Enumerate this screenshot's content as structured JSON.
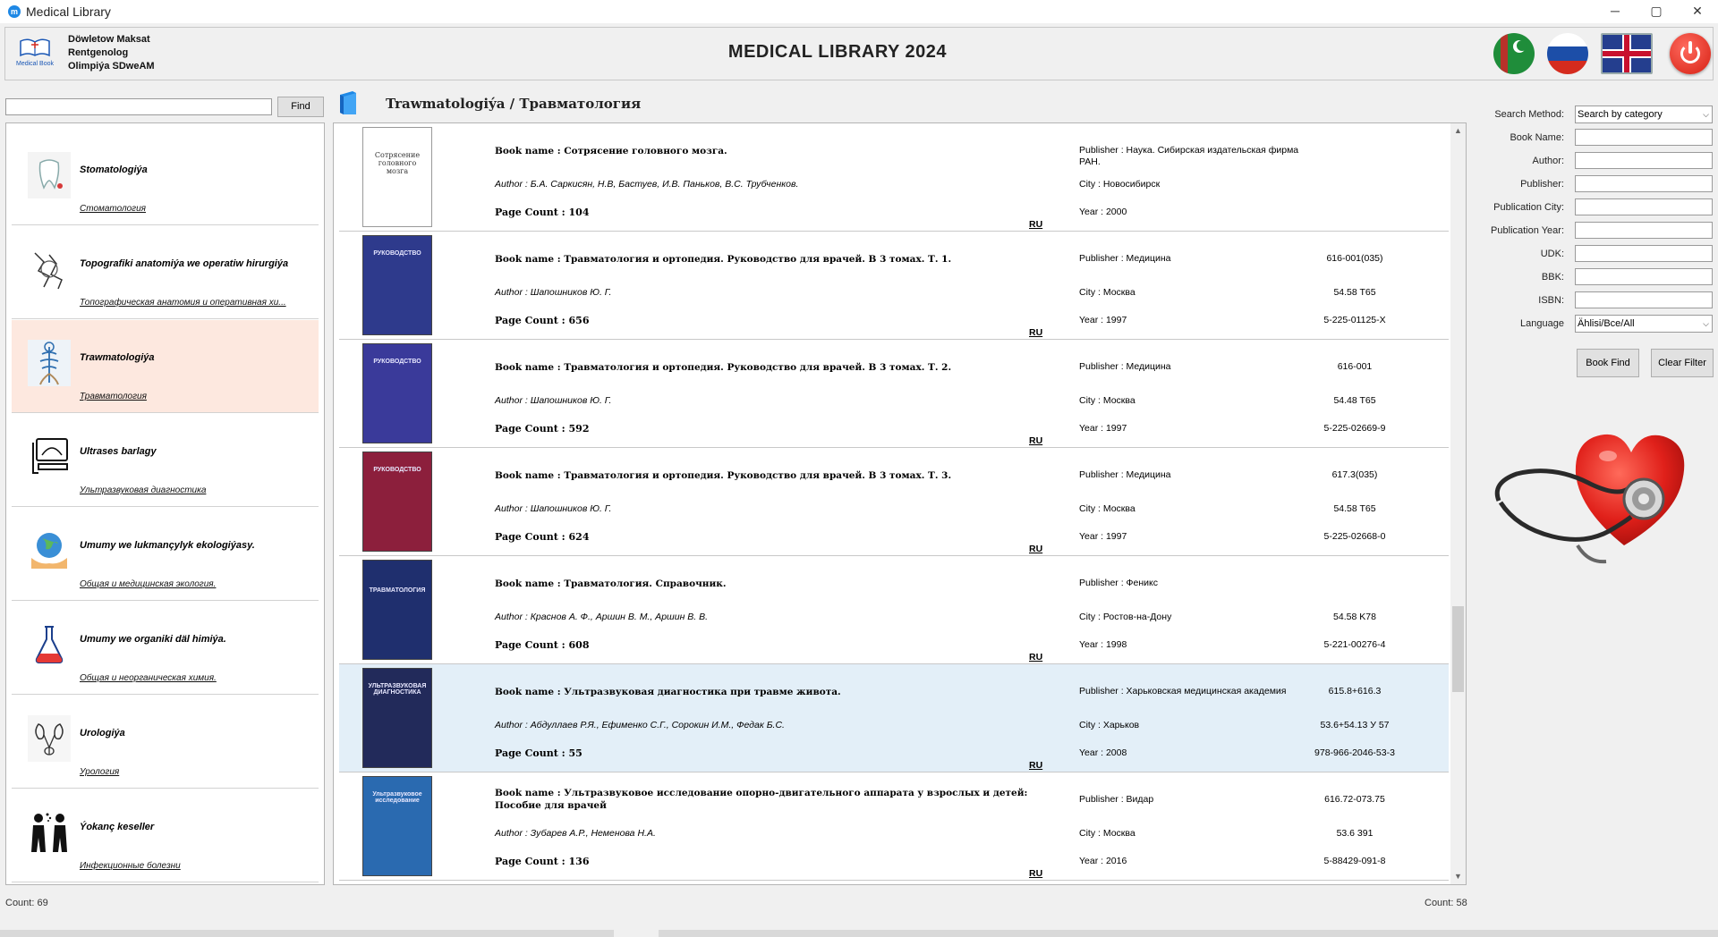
{
  "window": {
    "title": "Medical Library",
    "minimize": "─",
    "maximize": "▢",
    "close": "✕"
  },
  "header": {
    "logo_text": "Medical Book",
    "user_name": "Döwletow Maksat",
    "user_role": "Rentgenolog",
    "user_org": "Olimpiýa SDweAM",
    "app_title": "MEDICAL LIBRARY 2024"
  },
  "left": {
    "search_value": "",
    "find_label": "Find",
    "categories": [
      {
        "name": "Stomatologiýa",
        "sub": "Стоматология",
        "icon": "tooth-icon"
      },
      {
        "name": "Topografiki anatomiýa we operatiw hirurgiýa",
        "sub": "Топографическая анатомия и оперативная хи...",
        "icon": "anatomy-icon"
      },
      {
        "name": "Trawmatologiýa",
        "sub": "Травматология",
        "icon": "skeleton-icon"
      },
      {
        "name": "Ultrases barlagy",
        "sub": "Ультразвуковая диагностика",
        "icon": "ultrasound-icon"
      },
      {
        "name": "Umumy we lukmançylyk ekologiýasy.",
        "sub": "Общая и медицинская экология.",
        "icon": "globe-icon"
      },
      {
        "name": "Umumy we organiki däl himiýa.",
        "sub": "Общая и неорганическая химия.",
        "icon": "flask-icon"
      },
      {
        "name": "Urologiýa",
        "sub": "Урология",
        "icon": "kidney-icon"
      },
      {
        "name": "Ýokanç keseller",
        "sub": "Инфекционные болезни",
        "icon": "infection-icon"
      }
    ],
    "count": "Count: 69"
  },
  "category_header": "Trawmatologiýa / Травматология",
  "books": [
    {
      "name": "Book name : Сотрясение головного мозга.",
      "author": "Author : Б.А. Саркисян, Н.В, Бастуев, И.В. Паньков, В.С. Трубченков.",
      "pages": "Page Count : 104",
      "lang": "RU",
      "publisher": "Publisher : Наука. Сибирская издательская фирма РАН.",
      "city": "City : Новосибирск",
      "year": "Year : 2000",
      "udk": "",
      "bbk": "",
      "isbn": "",
      "cover_title": "Сотрясение головного мозга",
      "cover_color": "#ffffff"
    },
    {
      "name": "Book name : Травматология и ортопедия. Руководство для врачей. В 3 томах. Т. 1.",
      "author": "Author : Шапошников Ю. Г.",
      "pages": "Page Count : 656",
      "lang": "RU",
      "publisher": "Publisher : Медицина",
      "city": "City : Москва",
      "year": "Year : 1997",
      "udk": "616-001(035)",
      "bbk": "54.58 T65",
      "isbn": "5-225-01125-X",
      "cover_title": "РУКОВОДСТВО",
      "cover_color": "#2e3a8c"
    },
    {
      "name": "Book name : Травматология и ортопедия. Руководство для врачей. В 3 томах. Т. 2.",
      "author": "Author : Шапошников Ю. Г.",
      "pages": "Page Count : 592",
      "lang": "RU",
      "publisher": "Publisher : Медицина",
      "city": "City : Москва",
      "year": "Year : 1997",
      "udk": "616-001",
      "bbk": "54.48 T65",
      "isbn": "5-225-02669-9",
      "cover_title": "РУКОВОДСТВО",
      "cover_color": "#3a3a9a"
    },
    {
      "name": "Book name : Травматология и ортопедия. Руководство для врачей. В 3 томах. Т. 3.",
      "author": "Author : Шапошников Ю. Г.",
      "pages": "Page Count : 624",
      "lang": "RU",
      "publisher": "Publisher : Медицина",
      "city": "City : Москва",
      "year": "Year : 1997",
      "udk": "617.3(035)",
      "bbk": "54.58 T65",
      "isbn": "5-225-02668-0",
      "cover_title": "РУКОВОДСТВО",
      "cover_color": "#8c1f3c"
    },
    {
      "name": "Book name : Травматология. Справочник.",
      "author": "Author : Краснов А. Ф., Аршин В. М., Аршин В. В.",
      "pages": "Page Count : 608",
      "lang": "RU",
      "publisher": "Publisher : Феникс",
      "city": "City : Ростов-на-Дону",
      "year": "Year : 1998",
      "udk": "",
      "bbk": "54.58 K78",
      "isbn": "5-221-00276-4",
      "cover_title": "ТРАВМАТОЛОГИЯ",
      "cover_color": "#1f2f6e"
    },
    {
      "name": "Book name : Ультразвуковая диагностика при травме живота.",
      "author": "Author : Абдуллаев Р.Я., Ефименко С.Г., Сорокин И.М., Федак Б.С.",
      "pages": "Page Count : 55",
      "lang": "RU",
      "publisher": "Publisher : Харьковская медицинская академия",
      "city": "City : Харьков",
      "year": "Year : 2008",
      "udk": "615.8+616.3",
      "bbk": "53.6+54.13 У 57",
      "isbn": "978-966-2046-53-3",
      "cover_title": "УЛЬТРАЗВУКОВАЯ ДИАГНОСТИКА",
      "cover_color": "#222a5a"
    },
    {
      "name": "Book name : Ультразвуковое исследование опорно-двигательного аппарата у взрослых и детей: Пособие для врачей",
      "author": "Author : Зубарев А.Р., Неменова Н.А.",
      "pages": "Page Count : 136",
      "lang": "RU",
      "publisher": "Publisher : Видар",
      "city": "City : Москва",
      "year": "Year : 2016",
      "udk": "616.72-073.75",
      "bbk": "53.6 391",
      "isbn": "5-88429-091-8",
      "cover_title": "Ультразвуковое исследование",
      "cover_color": "#2a6ab0"
    }
  ],
  "books_count": "Count: 58",
  "filters": {
    "search_method_label": "Search Method:",
    "search_method_value": "Search by category",
    "book_name_label": "Book Name:",
    "author_label": "Author:",
    "publisher_label": "Publisher:",
    "city_label": "Publication City:",
    "year_label": "Publication Year:",
    "udk_label": "UDK:",
    "bbk_label": "BBK:",
    "isbn_label": "ISBN:",
    "language_label": "Language",
    "language_value": "Ählisi/Все/All",
    "book_find_label": "Book Find",
    "clear_filter_label": "Clear Filter"
  },
  "colors": {
    "selected_category": "#fde8df",
    "selected_book": "#e3eff8",
    "accent": "#1a57b5"
  }
}
